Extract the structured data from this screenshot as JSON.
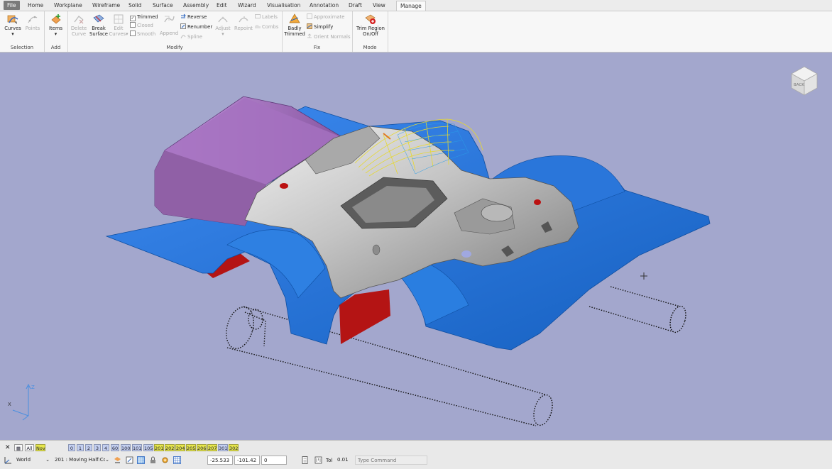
{
  "menu": [
    "File",
    "Home",
    "Workplane",
    "Wireframe",
    "Solid",
    "Surface",
    "Assembly",
    "Edit",
    "Wizard",
    "Visualisation",
    "Annotation",
    "Draft",
    "View",
    "Manage"
  ],
  "ribbon": {
    "selection": {
      "title": "Selection",
      "curves": "Curves",
      "points": "Points"
    },
    "add": {
      "title": "Add",
      "items": "Items"
    },
    "modify": {
      "title": "Modify",
      "delete_curve": [
        "Delete",
        "Curve"
      ],
      "break_surface": [
        "Break",
        "Surface"
      ],
      "edit_curves": [
        "Edit",
        "Curves"
      ],
      "trimmed": "Trimmed",
      "closed": "Closed",
      "smooth": "Smooth",
      "append": "Append",
      "reverse": "Reverse",
      "renumber": "Renumber",
      "spline": "Spline",
      "adjust": "Adjust",
      "repoint": "Repoint",
      "labels": "Labels",
      "combs": "Combs"
    },
    "fix": {
      "title": "Fix",
      "badly_trimmed": [
        "Badly",
        "Trimmed"
      ],
      "approximate": "Approximate",
      "simplify": "Simplify",
      "orient_normals": "Orient Normals"
    },
    "mode": {
      "title": "Mode",
      "trim_region": [
        "Trim Region",
        "On/Off"
      ]
    }
  },
  "viewcube": {
    "label": "BACK"
  },
  "axes": {
    "z": "Z",
    "x": "X"
  },
  "status": {
    "close": "✕",
    "all": "All",
    "nov": "Nov",
    "layers": [
      "0",
      "1",
      "2",
      "3",
      "4",
      "60",
      "100",
      "101",
      "105",
      "201",
      "202",
      "204",
      "205",
      "206",
      "207",
      "301",
      "302"
    ],
    "workplane": "World",
    "level": "201 : Moving Half:Co",
    "x": "-25.533",
    "y": "-101.42",
    "z": "0",
    "tol_label": "Tol",
    "tol": "0.01",
    "command_placeholder": "Type Command"
  },
  "colors": {
    "viewport": "#a3a7cd",
    "part": "#c2c2c2",
    "parting_surface": "#1f74d4",
    "side_core": "#9060a6",
    "runoff": "#b91414"
  }
}
